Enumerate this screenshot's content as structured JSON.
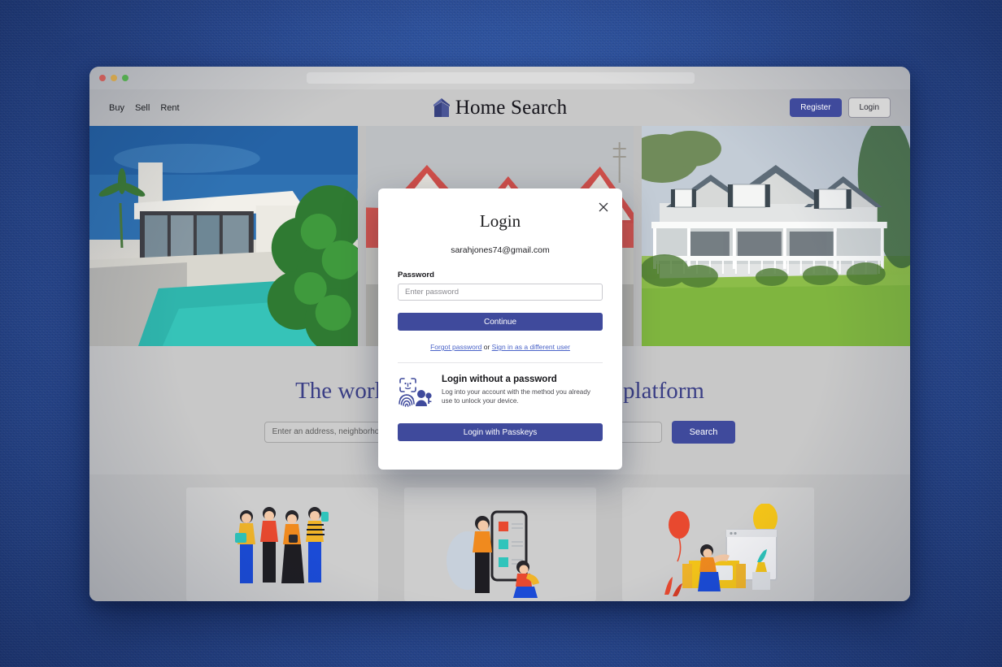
{
  "desktop": {
    "background_color": "#2f59ac"
  },
  "browser": {
    "traffic_lights": [
      "close-red",
      "minimize-yellow",
      "maximize-green"
    ],
    "url_value": ""
  },
  "site": {
    "brand_name": "Home Search",
    "logo_icon": "house-logo-icon",
    "nav": [
      {
        "label": "Buy"
      },
      {
        "label": "Sell"
      },
      {
        "label": "Rent"
      }
    ],
    "actions": {
      "register_label": "Register",
      "login_label": "Login"
    },
    "accent_color": "#3f4a9c"
  },
  "hero": {
    "images": [
      {
        "name": "modern-villa-with-pool"
      },
      {
        "name": "red-roof-gabled-house"
      },
      {
        "name": "white-shingle-house-with-lawn"
      }
    ],
    "title": "The world's best real estate search platform",
    "search": {
      "placeholder": "Enter an address, neighborhood, city, or ZIP code",
      "value": "",
      "button_label": "Search"
    }
  },
  "cards": [
    {
      "name": "card-group-of-people"
    },
    {
      "name": "card-person-with-checklist"
    },
    {
      "name": "card-person-celebrating"
    }
  ],
  "modal": {
    "title": "Login",
    "close_icon": "close-icon",
    "email": "sarahjones74@gmail.com",
    "password_label": "Password",
    "password_placeholder": "Enter password",
    "password_value": "",
    "continue_label": "Continue",
    "forgot_label": "Forgot password",
    "or_label": " or ",
    "different_user_label": "Sign in as a different user",
    "passkey": {
      "icons": [
        "face-id-icon",
        "fingerprint-icon",
        "person-key-icon"
      ],
      "title": "Login without a password",
      "description": "Log into your account with the method you already use to unlock your device.",
      "button_label": "Login with Passkeys"
    }
  }
}
